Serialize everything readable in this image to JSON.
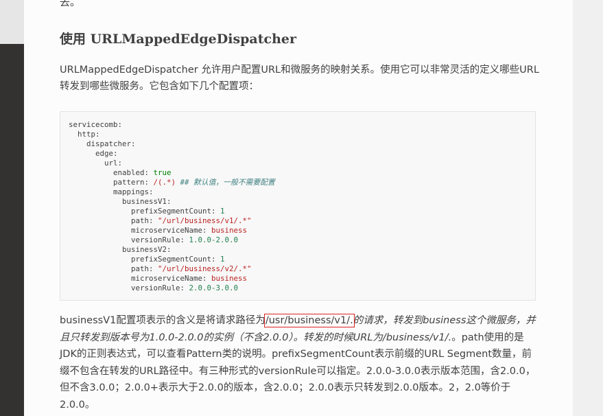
{
  "top_fragment": "去。",
  "section_title": "使用 URLMappedEdgeDispatcher",
  "intro_text": "URLMappedEdgeDispatcher 允许用户配置URL和微服务的映射关系。使用它可以非常灵活的定义哪些URL转发到哪些微服务。它包含如下几个配置项：",
  "code": {
    "l1": "servicecomb:",
    "l2": "  http:",
    "l3": "    dispatcher:",
    "l4": "      edge:",
    "l5": "        url:",
    "l6_key": "          enabled: ",
    "l6_val": "true",
    "l7_key": "          pattern: ",
    "l7_val": "/(.*)",
    "l7_comment": " ## 默认值，一般不需要配置",
    "l8": "          mappings:",
    "l9": "            businessV1:",
    "l10_key": "              prefixSegmentCount: ",
    "l10_val": "1",
    "l11_key": "              path: ",
    "l11_val": "\"/url/business/v1/.*\"",
    "l12_key": "              microserviceName: ",
    "l12_val": "business",
    "l13_key": "              versionRule: ",
    "l13_val": "1.0.0-2.0.0",
    "l14": "            businessV2:",
    "l15_key": "              prefixSegmentCount: ",
    "l15_val": "1",
    "l16_key": "              path: ",
    "l16_val": "\"/url/business/v2/.*\"",
    "l17_key": "              microserviceName: ",
    "l17_val": "business",
    "l18_key": "              versionRule: ",
    "l18_val": "2.0.0-3.0.0"
  },
  "explanation": {
    "part1": "businessV1配置项表示的含义是将请求路径为",
    "highlighted": "/usr/business/v1/.",
    "part2_italic": "的请求，转发到business这个微服务，并且只转发到版本号为1.0.0-2.0.0的实例（不含2.0.0）。转发的时候URL为/business/v1/.",
    "part3": "。path使用的是JDK的正则表达式，可以查看Pattern类的说明。prefixSegmentCount表示前缀的URL Segment数量，前缀不包含在转发的URL路径中。有三种形式的versionRule可以指定。2.0.0-3.0.0表示版本范围，含2.0.0，但不含3.0.0；2.0.0+表示大于2.0.0的版本，含2.0.0；2.0.0表示只转发到2.0.0版本。2，2.0等价于2.0.0。"
  }
}
